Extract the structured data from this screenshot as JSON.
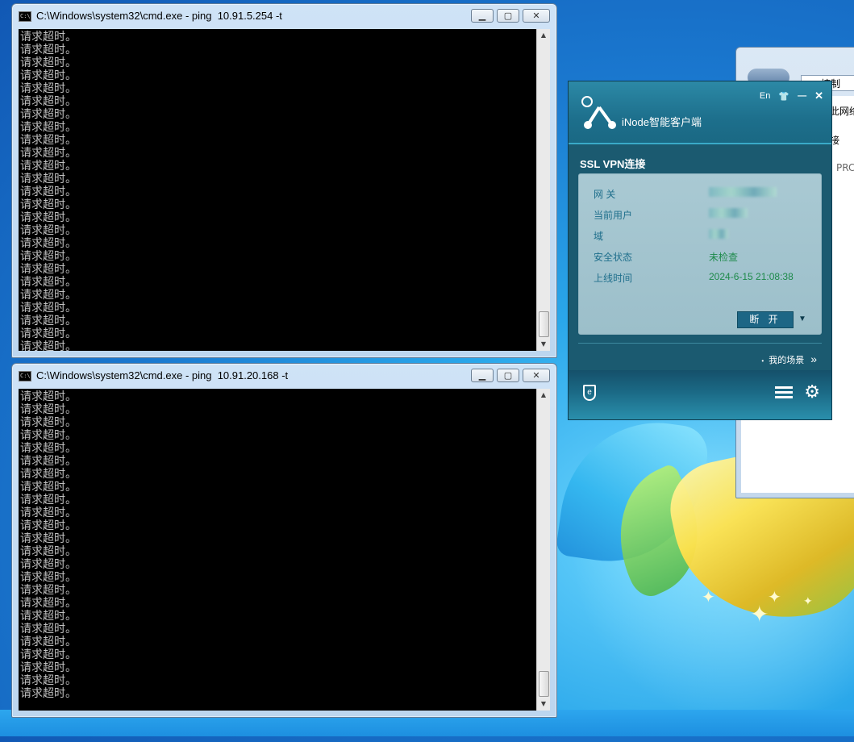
{
  "desktop": {},
  "cmd_windows": [
    {
      "title": "C:\\Windows\\system32\\cmd.exe - ping  10.91.5.254 -t",
      "lines": [
        "请求超时。",
        "请求超时。",
        "请求超时。",
        "请求超时。",
        "请求超时。",
        "请求超时。",
        "请求超时。",
        "请求超时。",
        "请求超时。",
        "请求超时。",
        "请求超时。",
        "请求超时。",
        "请求超时。",
        "请求超时。",
        "请求超时。",
        "请求超时。",
        "请求超时。",
        "请求超时。",
        "请求超时。",
        "请求超时。",
        "请求超时。",
        "请求超时。",
        "请求超时。",
        "请求超时。",
        "请求超时。"
      ]
    },
    {
      "title": "C:\\Windows\\system32\\cmd.exe - ping  10.91.20.168 -t",
      "lines": [
        "请求超时。",
        "请求超时。",
        "请求超时。",
        "请求超时。",
        "请求超时。",
        "请求超时。",
        "请求超时。",
        "请求超时。",
        "请求超时。",
        "请求超时。",
        "请求超时。",
        "请求超时。",
        "请求超时。",
        "请求超时。",
        "请求超时。",
        "请求超时。",
        "请求超时。",
        "请求超时。",
        "请求超时。",
        "请求超时。",
        "请求超时。",
        "请求超时。",
        "请求超时。",
        "请求超时。"
      ]
    }
  ],
  "control_panel": {
    "address": "控制",
    "text_1": "此网络",
    "text_2": "接",
    "text_3": "PRC"
  },
  "inode": {
    "app_name": "iNode智能客户端",
    "lang_toggle": "En",
    "section_title": "SSL VPN连接",
    "rows": [
      {
        "label": "网  关",
        "value": ""
      },
      {
        "label": "当前用户",
        "value": ""
      },
      {
        "label": "域",
        "value": ""
      },
      {
        "label": "安全状态",
        "value": "未检查"
      },
      {
        "label": "上线时间",
        "value": "2024-6-15 21:08:38"
      }
    ],
    "disconnect_label": "断 开",
    "scene_link": "我的场景",
    "colors": {
      "header": "#1d6f8c",
      "card": "#a9c9d3",
      "status_green": "#1d8a4a",
      "button": "#1d6685"
    }
  }
}
